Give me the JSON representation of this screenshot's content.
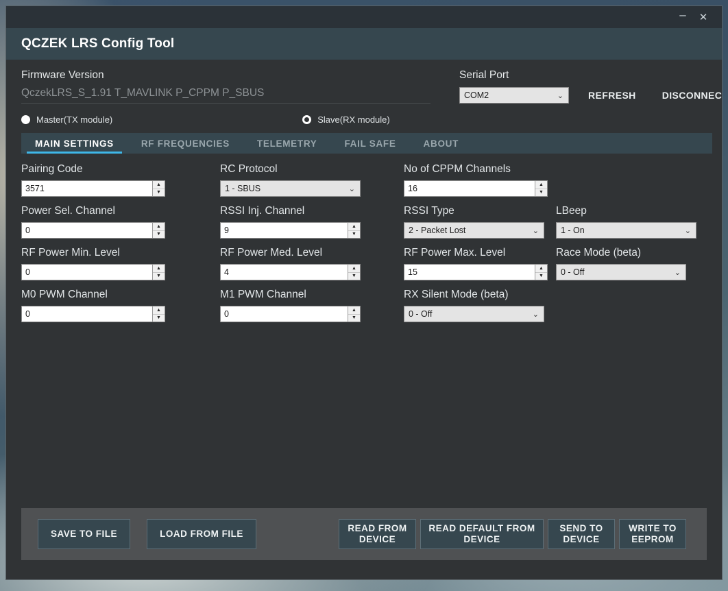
{
  "window": {
    "minimize_icon": "minimize-icon",
    "minimize_glyph": "–",
    "close_icon": "close-icon",
    "close_glyph": "✕",
    "app_title": "QCZEK LRS Config Tool"
  },
  "header": {
    "firmware_label": "Firmware Version",
    "firmware_value": "QczekLRS_S_1.91 T_MAVLINK P_CPPM P_SBUS",
    "serial_label": "Serial Port",
    "serial_value": "COM2",
    "refresh_label": "REFRESH",
    "disconnect_label": "DISCONNECT"
  },
  "mode": {
    "master_label": "Master(TX module)",
    "slave_label": "Slave(RX module)",
    "selected": "slave"
  },
  "tabs": [
    {
      "label": "MAIN SETTINGS",
      "active": true
    },
    {
      "label": "RF FREQUENCIES",
      "active": false
    },
    {
      "label": "TELEMETRY",
      "active": false
    },
    {
      "label": "FAIL SAFE",
      "active": false
    },
    {
      "label": "ABOUT",
      "active": false
    }
  ],
  "fields": {
    "pairing_code": {
      "label": "Pairing Code",
      "value": "3571"
    },
    "rc_protocol": {
      "label": "RC Protocol",
      "value": "1 - SBUS"
    },
    "cppm_channels": {
      "label": "No of CPPM Channels",
      "value": "16"
    },
    "power_sel_channel": {
      "label": "Power Sel. Channel",
      "value": "0"
    },
    "rssi_inj_channel": {
      "label": "RSSI Inj. Channel",
      "value": "9"
    },
    "rssi_type": {
      "label": "RSSI Type",
      "value": "2 - Packet Lost"
    },
    "lbeep": {
      "label": "LBeep",
      "value": "1 - On"
    },
    "rf_power_min": {
      "label": "RF Power Min. Level",
      "value": "0"
    },
    "rf_power_med": {
      "label": "RF Power Med. Level",
      "value": "4"
    },
    "rf_power_max": {
      "label": "RF Power Max. Level",
      "value": "15"
    },
    "race_mode": {
      "label": "Race Mode (beta)",
      "value": "0 - Off"
    },
    "m0_pwm_channel": {
      "label": "M0 PWM Channel",
      "value": "0"
    },
    "m1_pwm_channel": {
      "label": "M1 PWM Channel",
      "value": "0"
    },
    "rx_silent_mode": {
      "label": "RX Silent Mode (beta)",
      "value": "0 - Off"
    }
  },
  "footer": {
    "save_to_file": "SAVE TO FILE",
    "load_from_file": "LOAD FROM FILE",
    "read_from_device": "READ FROM DEVICE",
    "read_default_from_device": "READ DEFAULT FROM DEVICE",
    "send_to_device": "SEND TO DEVICE",
    "write_to_eeprom": "WRITE TO EEPROM"
  },
  "icons": {
    "spin_up": "▲",
    "spin_down": "▼",
    "chevron_down": "⌄"
  },
  "colors": {
    "accent": "#3fb7e8",
    "appbar": "#36474f",
    "window_bg": "#303335",
    "footer_bg": "#4f5153"
  }
}
